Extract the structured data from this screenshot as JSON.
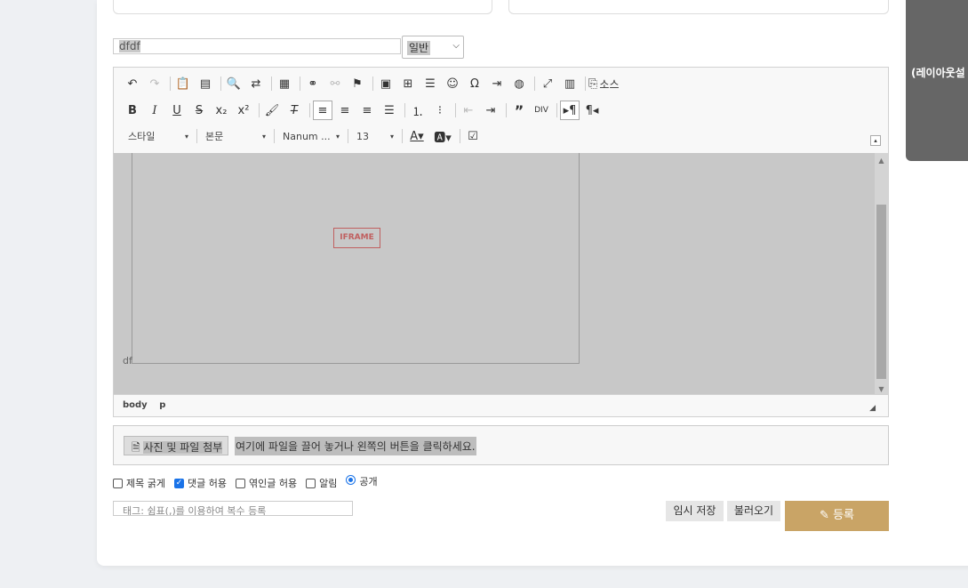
{
  "side_tab": {
    "label": "(레이아웃설"
  },
  "title": {
    "value": "dfdf",
    "select_value": "일반"
  },
  "toolbar": {
    "row1": [
      "undo-icon",
      "redo-icon",
      "sep",
      "paste-icon",
      "paste-text-icon",
      "sep",
      "find-icon",
      "replace-icon",
      "sep",
      "select-all-icon",
      "sep",
      "link-icon",
      "unlink-icon",
      "anchor-icon",
      "sep",
      "image-icon",
      "table-icon",
      "hr-icon",
      "smiley-icon",
      "special-char-icon",
      "pagebreak-icon",
      "iframe-icon",
      "sep",
      "maximize-icon",
      "show-blocks-icon",
      "sep",
      "source-icon"
    ],
    "source_label": "소스",
    "row2": [
      "B",
      "I",
      "U",
      "S",
      "x₂",
      "x²"
    ],
    "style_combo": "스타일",
    "format_combo": "본문",
    "font_combo": "Nanum ...",
    "size_combo": "13",
    "collapse": "▴"
  },
  "content": {
    "iframe_label": "IFRAME",
    "text": "df"
  },
  "statusbar": {
    "path": [
      "body",
      "p"
    ]
  },
  "attach": {
    "button_label": "사진 및 파일 첨부",
    "hint": "여기에 파일을 끌어 놓거나 왼쪽의 버튼을 클릭하세요."
  },
  "options": {
    "bold_title": "제목 굵게",
    "allow_comment": "댓글 허용",
    "allow_reply": "엮인글 허용",
    "notify": "알림",
    "public": "공개"
  },
  "tags": {
    "placeholder": "태그: 쉼표(,)를 이용하여 복수 등록"
  },
  "buttons": {
    "temp_save": "임시 저장",
    "load": "불러오기",
    "submit": "등록"
  }
}
